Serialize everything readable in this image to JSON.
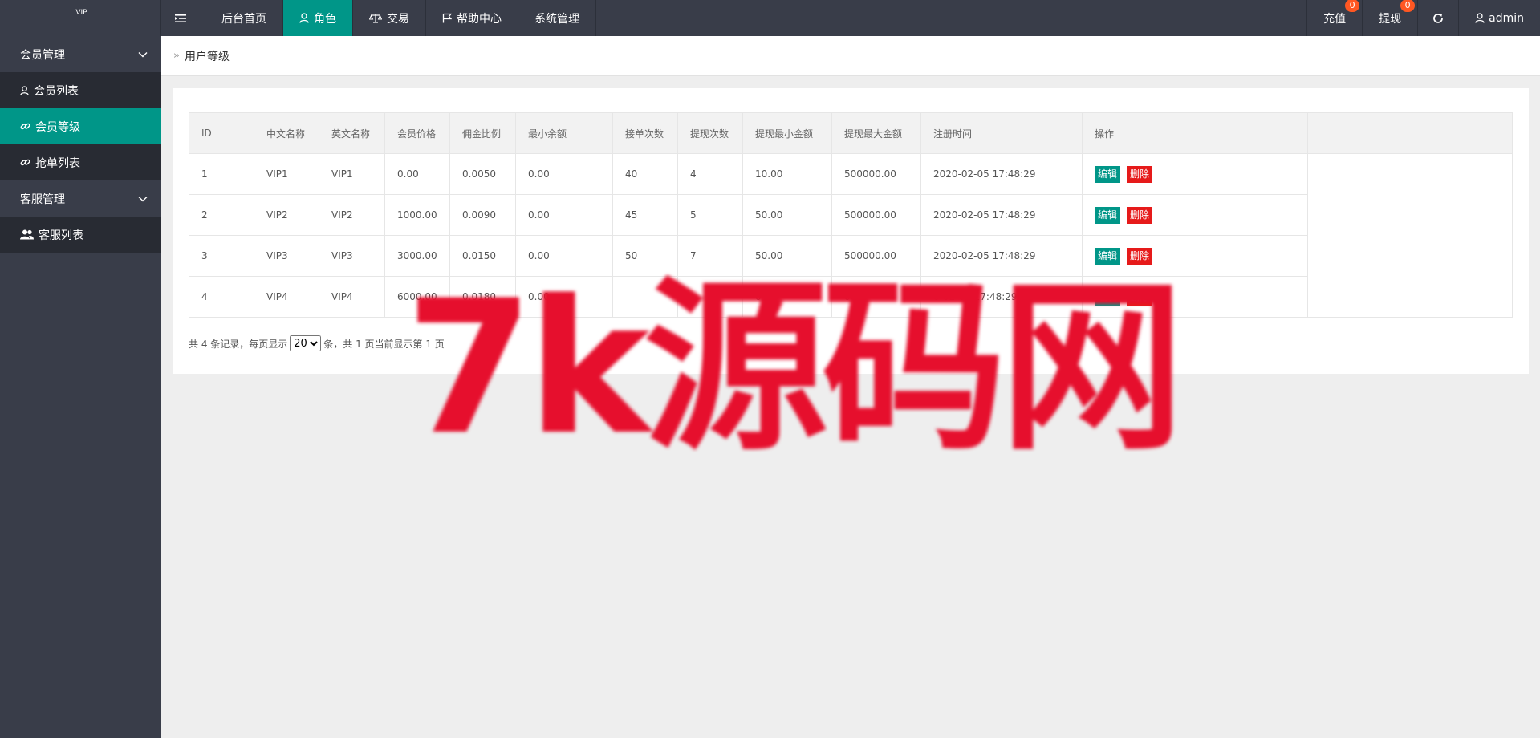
{
  "app": {
    "logo_main": "VIP",
    "logo_sup": "VIP"
  },
  "topnav": {
    "items": [
      {
        "label": "后台首页"
      },
      {
        "label": "角色"
      },
      {
        "label": "交易"
      },
      {
        "label": "帮助中心"
      },
      {
        "label": "系统管理"
      }
    ],
    "recharge_label": "充值",
    "recharge_count": "0",
    "withdraw_label": "提现",
    "withdraw_count": "0",
    "user_label": "admin"
  },
  "sidebar": {
    "group1": "会员管理",
    "items1": [
      {
        "label": "会员列表"
      },
      {
        "label": "会员等级"
      },
      {
        "label": "抢单列表"
      }
    ],
    "group2": "客服管理",
    "items2": [
      {
        "label": "客服列表"
      }
    ]
  },
  "breadcrumb": {
    "current": "用户等级"
  },
  "table": {
    "headers": [
      "ID",
      "中文名称",
      "英文名称",
      "会员价格",
      "佣金比例",
      "最小余额",
      "接单次数",
      "提现次数",
      "提现最小金额",
      "提现最大金额",
      "注册时间",
      "操作"
    ],
    "rows": [
      [
        "1",
        "VIP1",
        "VIP1",
        "0.00",
        "0.0050",
        "0.00",
        "40",
        "4",
        "10.00",
        "500000.00",
        "2020-02-05 17:48:29"
      ],
      [
        "2",
        "VIP2",
        "VIP2",
        "1000.00",
        "0.0090",
        "0.00",
        "45",
        "5",
        "50.00",
        "500000.00",
        "2020-02-05 17:48:29"
      ],
      [
        "3",
        "VIP3",
        "VIP3",
        "3000.00",
        "0.0150",
        "0.00",
        "50",
        "7",
        "50.00",
        "500000.00",
        "2020-02-05 17:48:29"
      ],
      [
        "4",
        "VIP4",
        "VIP4",
        "6000.00",
        "0.0180",
        "0.00",
        "",
        "",
        "0",
        "00",
        "0-02-05 17:48:29"
      ]
    ],
    "edit_label": "编辑",
    "delete_label": "删除"
  },
  "pager": {
    "prefix": "共 4 条记录，每页显示",
    "page_size": "20",
    "suffix": "条，共 1 页当前显示第 1 页"
  },
  "watermark": "7k源码网",
  "colors": {
    "accent": "#009688",
    "danger": "#e61a1a",
    "header_bg": "#393d49",
    "badge": "#ff5722"
  }
}
